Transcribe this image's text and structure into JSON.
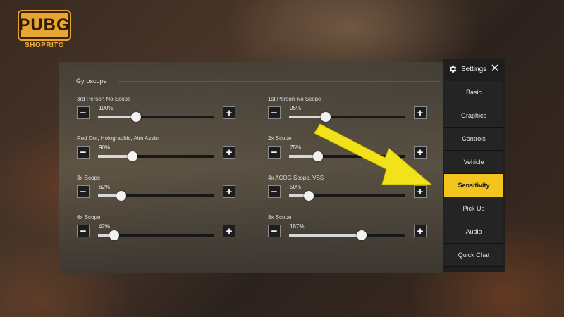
{
  "logo": {
    "name": "PUBG",
    "sub": "SHOPRITO"
  },
  "panel": {
    "section_title": "Gyroscope",
    "sliders": [
      {
        "label": "3rd Person No Scope",
        "value": "100%",
        "level": 0.33
      },
      {
        "label": "1st Person No Scope",
        "value": "95%",
        "level": 0.32
      },
      {
        "label": "Red Dot, Holographic, Aim Assist",
        "value": "90%",
        "level": 0.3
      },
      {
        "label": "2x Scope",
        "value": "75%",
        "level": 0.25
      },
      {
        "label": "3x Scope",
        "value": "62%",
        "level": 0.2
      },
      {
        "label": "4x ACOG Scope, VSS",
        "value": "50%",
        "level": 0.17
      },
      {
        "label": "6x Scope",
        "value": "42%",
        "level": 0.14
      },
      {
        "label": "8x Scope",
        "value": "187%",
        "level": 0.63
      }
    ],
    "minus_symbol": "−",
    "plus_symbol": "+"
  },
  "sidebar": {
    "title": "Settings",
    "close_symbol": "✕",
    "gear_icon": "gear-icon",
    "items": [
      {
        "label": "Basic",
        "active": false
      },
      {
        "label": "Graphics",
        "active": false
      },
      {
        "label": "Controls",
        "active": false
      },
      {
        "label": "Vehicle",
        "active": false
      },
      {
        "label": "Sensitivity",
        "active": true
      },
      {
        "label": "Pick Up",
        "active": false
      },
      {
        "label": "Audio",
        "active": false
      },
      {
        "label": "Quick Chat",
        "active": false
      }
    ]
  },
  "colors": {
    "accent": "#f3c31e",
    "arrow": "#f2e21a"
  }
}
